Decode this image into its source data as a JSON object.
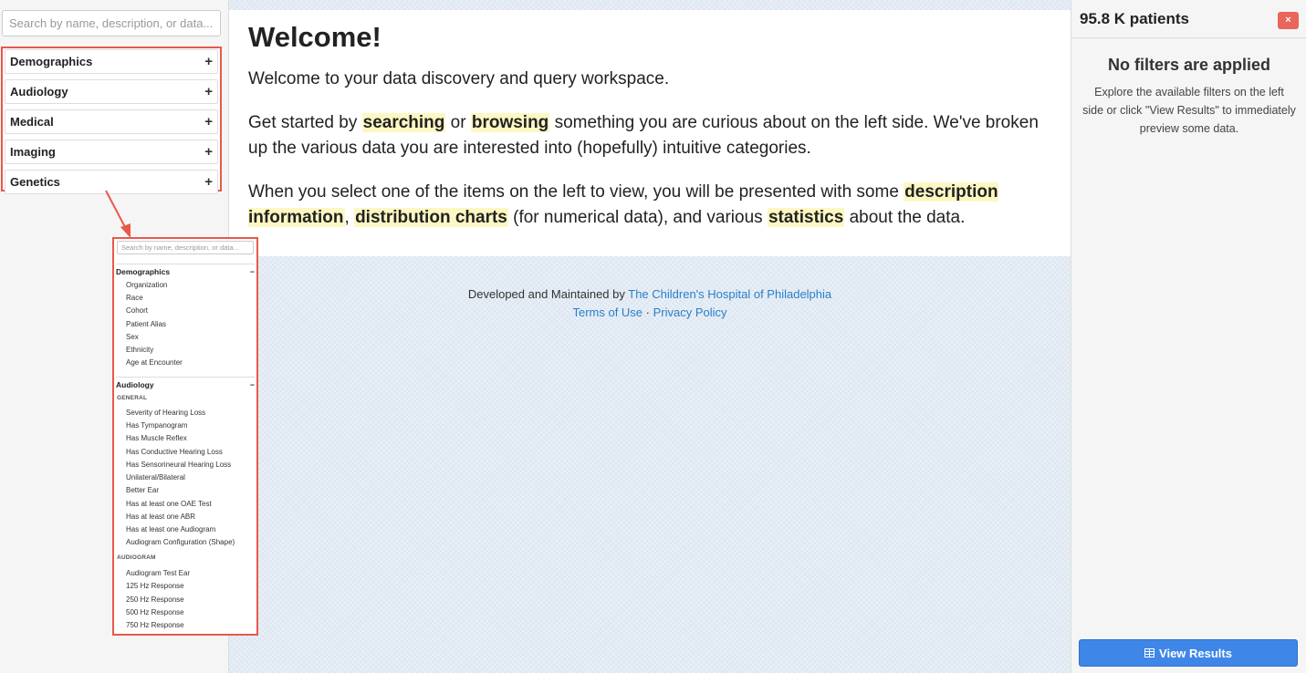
{
  "sidebar": {
    "search_placeholder": "Search by name, description, or data...",
    "categories": [
      {
        "label": "Demographics",
        "toggle": "+"
      },
      {
        "label": "Audiology",
        "toggle": "+"
      },
      {
        "label": "Medical",
        "toggle": "+"
      },
      {
        "label": "Imaging",
        "toggle": "+"
      },
      {
        "label": "Genetics",
        "toggle": "+"
      }
    ]
  },
  "preview": {
    "search_placeholder": "Search by name, description, or data...",
    "demographics": {
      "label": "Demographics",
      "toggle": "−",
      "items": [
        "Organization",
        "Race",
        "Cohort",
        "Patient Alias",
        "Sex",
        "Ethnicity",
        "Age at Encounter"
      ]
    },
    "audiology": {
      "label": "Audiology",
      "toggle": "−",
      "general_heading": "GENERAL",
      "general_items": [
        "Severity of Hearing Loss",
        "Has Tympanogram",
        "Has Muscle Reflex",
        "Has Conductive Hearing Loss",
        "Has Sensorineural Hearing Loss",
        "Unilateral/Bilateral",
        "Better Ear",
        "Has at least one OAE Test",
        "Has at least one ABR",
        "Has at least one Audiogram",
        "Audiogram Configuration (Shape)"
      ],
      "audiogram_heading": "AUDIOGRAM",
      "audiogram_items": [
        "Audiogram Test Ear",
        "125 Hz Response",
        "250 Hz Response",
        "500 Hz Response",
        "750 Hz Response"
      ]
    }
  },
  "main": {
    "title": "Welcome!",
    "intro": "Welcome to your data discovery and query workspace.",
    "p2": {
      "t1": "Get started by ",
      "h1": "searching",
      "t2": " or ",
      "h2": "browsing",
      "t3": " something you are curious about on the left side. We've broken up the various data you are interested into (hopefully) intuitive categories."
    },
    "p3": {
      "t1": "When you select one of the items on the left to view, you will be presented with some ",
      "h1": "description information",
      "t2": ", ",
      "h2": "distribution charts",
      "t3": " (for numerical data), and various ",
      "h3": "statistics",
      "t4": " about the data."
    },
    "footer": {
      "developed_by": "Developed and Maintained by ",
      "org_link": "The Children's Hospital of Philadelphia",
      "terms_link": "Terms of Use",
      "separator": " · ",
      "privacy_link": "Privacy Policy"
    }
  },
  "right_panel": {
    "patient_count": "95.8 K patients",
    "close_label": "×",
    "no_filters_title": "No filters are applied",
    "no_filters_desc": "Explore the available filters on the left side or click \"View Results\" to immediately preview some data.",
    "view_results_label": "View Results",
    "view_results_icon": "table-icon"
  },
  "colors": {
    "highlight_border": "#e8594a",
    "keyword_highlight": "#fdf7c3",
    "link": "#2a7fc6",
    "primary_button": "#3e87e8",
    "close_button": "#e8665c"
  }
}
